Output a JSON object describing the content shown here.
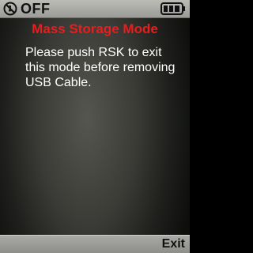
{
  "status_bar": {
    "profile_text": "OFF",
    "profile_icon": "silent-icon",
    "battery_icon": "battery-full-icon"
  },
  "dialog": {
    "title": "Mass Storage Mode",
    "message": "Please push RSK to exit this mode before removing USB Cable."
  },
  "softkeys": {
    "right_label": "Exit"
  },
  "colors": {
    "title": "#e81d1d",
    "message": "#ffffff"
  }
}
